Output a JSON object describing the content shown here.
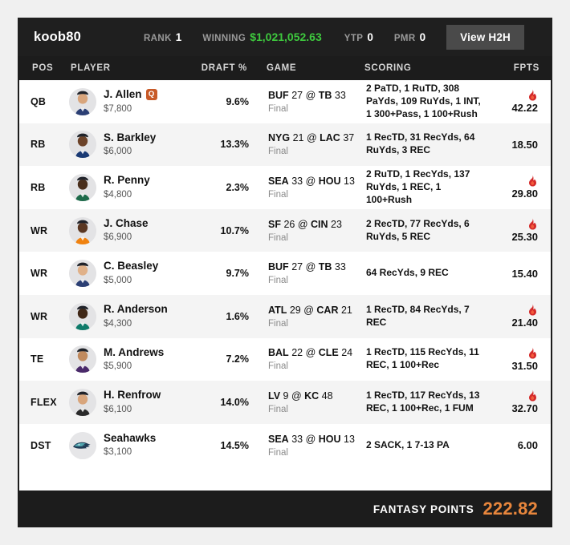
{
  "header": {
    "username": "koob80",
    "rank_label": "RANK",
    "rank_value": "1",
    "winning_label": "WINNING",
    "winning_value": "$1,021,052.63",
    "ytp_label": "YTP",
    "ytp_value": "0",
    "pmr_label": "PMR",
    "pmr_value": "0",
    "h2h_button": "View H2H",
    "winning_color": "#3ec93e"
  },
  "columns": {
    "pos": "POS",
    "player": "PLAYER",
    "draft": "DRAFT %",
    "game": "GAME",
    "scoring": "SCORING",
    "fpts": "FPTS"
  },
  "players": [
    {
      "pos": "QB",
      "name": "J. Allen",
      "badge": "Q",
      "salary": "$7,800",
      "draft_pct": "9.6%",
      "game_away": "BUF",
      "game_away_score": "27",
      "game_home": "TB",
      "game_home_score": "33",
      "status": "Final",
      "scoring": "2 PaTD, 1 RuTD, 308 PaYds, 109 RuYds, 1 INT, 1 300+Pass, 1 100+Rush",
      "fpts": "42.22",
      "hot": true,
      "avatar": "player-headshot-allen"
    },
    {
      "pos": "RB",
      "name": "S. Barkley",
      "badge": "",
      "salary": "$6,000",
      "draft_pct": "13.3%",
      "game_away": "NYG",
      "game_away_score": "21",
      "game_home": "LAC",
      "game_home_score": "37",
      "status": "Final",
      "scoring": "1 RecTD, 31 RecYds, 64 RuYds, 3 REC",
      "fpts": "18.50",
      "hot": false,
      "avatar": "player-headshot-barkley"
    },
    {
      "pos": "RB",
      "name": "R. Penny",
      "badge": "",
      "salary": "$4,800",
      "draft_pct": "2.3%",
      "game_away": "SEA",
      "game_away_score": "33",
      "game_home": "HOU",
      "game_home_score": "13",
      "status": "Final",
      "scoring": "2 RuTD, 1 RecYds, 137 RuYds, 1 REC, 1 100+Rush",
      "fpts": "29.80",
      "hot": true,
      "avatar": "player-headshot-penny"
    },
    {
      "pos": "WR",
      "name": "J. Chase",
      "badge": "",
      "salary": "$6,900",
      "draft_pct": "10.7%",
      "game_away": "SF",
      "game_away_score": "26",
      "game_home": "CIN",
      "game_home_score": "23",
      "status": "Final",
      "scoring": "2 RecTD, 77 RecYds, 6 RuYds, 5 REC",
      "fpts": "25.30",
      "hot": true,
      "avatar": "player-headshot-chase"
    },
    {
      "pos": "WR",
      "name": "C. Beasley",
      "badge": "",
      "salary": "$5,000",
      "draft_pct": "9.7%",
      "game_away": "BUF",
      "game_away_score": "27",
      "game_home": "TB",
      "game_home_score": "33",
      "status": "Final",
      "scoring": "64 RecYds, 9 REC",
      "fpts": "15.40",
      "hot": false,
      "avatar": "player-headshot-beasley"
    },
    {
      "pos": "WR",
      "name": "R. Anderson",
      "badge": "",
      "salary": "$4,300",
      "draft_pct": "1.6%",
      "game_away": "ATL",
      "game_away_score": "29",
      "game_home": "CAR",
      "game_home_score": "21",
      "status": "Final",
      "scoring": "1 RecTD, 84 RecYds, 7 REC",
      "fpts": "21.40",
      "hot": true,
      "avatar": "player-headshot-anderson"
    },
    {
      "pos": "TE",
      "name": "M. Andrews",
      "badge": "",
      "salary": "$5,900",
      "draft_pct": "7.2%",
      "game_away": "BAL",
      "game_away_score": "22",
      "game_home": "CLE",
      "game_home_score": "24",
      "status": "Final",
      "scoring": "1 RecTD, 115 RecYds, 11 REC, 1 100+Rec",
      "fpts": "31.50",
      "hot": true,
      "avatar": "player-headshot-andrews"
    },
    {
      "pos": "FLEX",
      "name": "H. Renfrow",
      "badge": "",
      "salary": "$6,100",
      "draft_pct": "14.0%",
      "game_away": "LV",
      "game_away_score": "9",
      "game_home": "KC",
      "game_home_score": "48",
      "status": "Final",
      "scoring": "1 RecTD, 117 RecYds, 13 REC, 1 100+Rec, 1 FUM",
      "fpts": "32.70",
      "hot": true,
      "avatar": "player-headshot-renfrow"
    },
    {
      "pos": "DST",
      "name": "Seahawks",
      "badge": "",
      "salary": "$3,100",
      "draft_pct": "14.5%",
      "game_away": "SEA",
      "game_away_score": "33",
      "game_home": "HOU",
      "game_home_score": "13",
      "status": "Final",
      "scoring": "2 SACK, 1 7-13 PA",
      "fpts": "6.00",
      "hot": false,
      "avatar": "team-logo-seahawks"
    }
  ],
  "footer": {
    "label": "FANTASY POINTS",
    "total": "222.82",
    "total_color": "#e8863c"
  }
}
